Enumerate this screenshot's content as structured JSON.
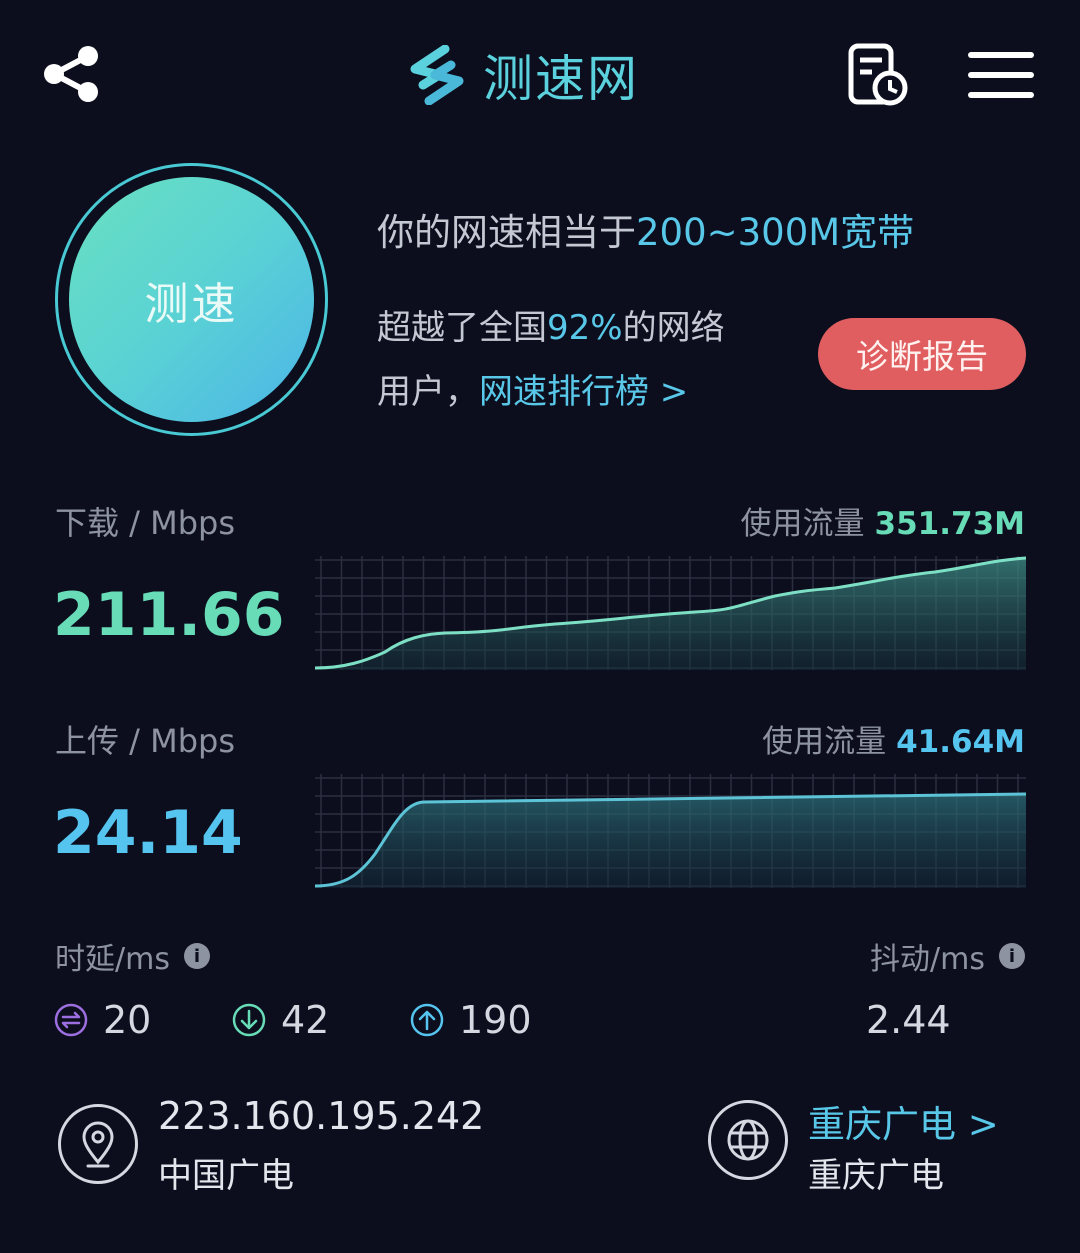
{
  "header": {
    "app_name": "测速网",
    "brand_color": "#5ad1dc",
    "icons": [
      "share-icon",
      "logo-mark-icon",
      "history-icon",
      "menu-icon"
    ]
  },
  "test_button": {
    "label": "测速"
  },
  "summary": {
    "line1_prefix": "你的网速相当于",
    "line1_highlight": "200~300M宽带",
    "line2_prefix": "超越了全国",
    "line2_highlight": "92%",
    "line2_suffix": "的网络",
    "line3_prefix": "用户，",
    "line3_link": "网速排行榜 >",
    "diagnose_button": "诊断报告"
  },
  "download": {
    "label": "下载 / Mbps",
    "value": "211.66",
    "usage_label": "使用流量",
    "usage_value": "351.73M",
    "color": "#67dcb7"
  },
  "upload": {
    "label": "上传 / Mbps",
    "value": "24.14",
    "usage_label": "使用流量",
    "usage_value": "41.64M",
    "color": "#55c4ef"
  },
  "latency": {
    "label": "时延/ms",
    "idle": "20",
    "down": "42",
    "up": "190",
    "colors": {
      "idle": "#9d6ee0",
      "down": "#67dcb7",
      "up": "#55c4ef"
    }
  },
  "jitter": {
    "label": "抖动/ms",
    "value": "2.44"
  },
  "client": {
    "ip": "223.160.195.242",
    "isp": "中国广电"
  },
  "server": {
    "name": "重庆广电 >",
    "isp": "重庆广电"
  }
}
